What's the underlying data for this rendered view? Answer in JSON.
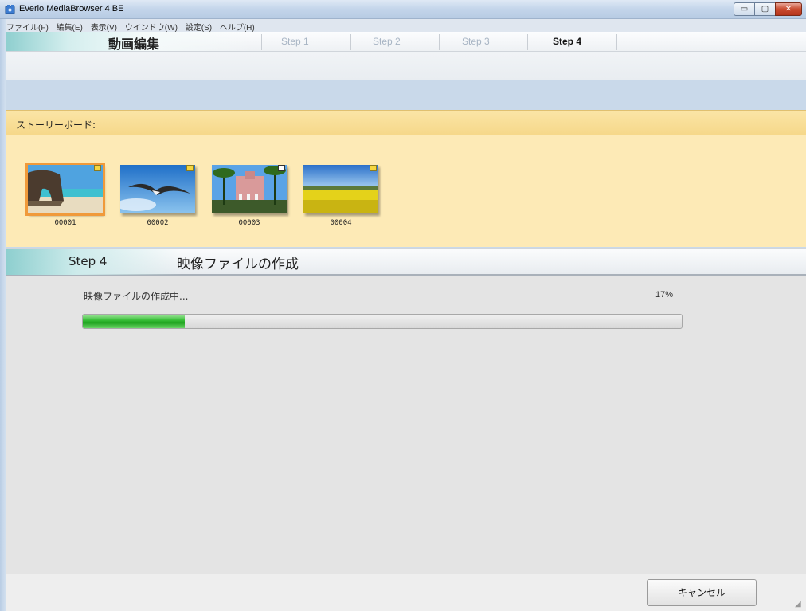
{
  "window": {
    "title": "Everio MediaBrowser 4 BE",
    "minimize_glyph": "▭",
    "maximize_glyph": "▢",
    "close_glyph": "✕"
  },
  "menu": [
    "ファイル(F)",
    "編集(E)",
    "表示(V)",
    "ウインドウ(W)",
    "設定(S)",
    "ヘルプ(H)"
  ],
  "steps": {
    "section_title": "動画編集",
    "tabs": [
      "Step 1",
      "Step 2",
      "Step 3",
      "Step 4"
    ],
    "active_index": 3
  },
  "storyboard": {
    "label": "ストーリーボード:",
    "items": [
      {
        "label": "00001",
        "selected": true
      },
      {
        "label": "00002",
        "selected": false
      },
      {
        "label": "00003",
        "selected": false
      },
      {
        "label": "00004",
        "selected": false
      }
    ]
  },
  "step4": {
    "step_label": "Step 4",
    "title": "映像ファイルの作成"
  },
  "progress": {
    "label": "映像ファイルの作成中...",
    "percent_text": "17%",
    "value": 0.17
  },
  "bottom": {
    "cancel_label": "キャンセル"
  },
  "colors": {
    "accent_teal": "#8fcfcf",
    "storyboard_bg": "#fdeab6",
    "progress_green": "#39c039",
    "selection_orange": "#f09a3a"
  }
}
